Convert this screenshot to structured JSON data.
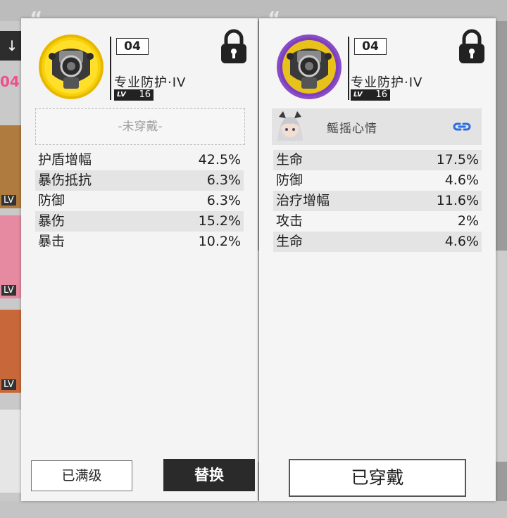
{
  "background": {
    "sort_arrow": "↓",
    "side_number": "04",
    "side_lv_label": "LV"
  },
  "left_card": {
    "item_number": "04",
    "equip_name": "专业防护·IV",
    "lv_label": "LV",
    "level": "16",
    "unworn_label": "-未穿戴-",
    "stats": [
      {
        "name": "护盾增幅",
        "value": "42.5%"
      },
      {
        "name": "暴伤抵抗",
        "value": "6.3%"
      },
      {
        "name": "防御",
        "value": "6.3%"
      },
      {
        "name": "暴伤",
        "value": "15.2%"
      },
      {
        "name": "暴击",
        "value": "10.2%"
      }
    ],
    "max_level_button": "已满级",
    "replace_button": "替换",
    "icon_ring_color": "#e8b800",
    "lock_icon": "padlock-icon"
  },
  "right_card": {
    "item_number": "04",
    "equip_name": "专业防护·IV",
    "lv_label": "LV",
    "level": "16",
    "wearer_name": "鳐摇心情",
    "stats": [
      {
        "name": "生命",
        "value": "17.5%"
      },
      {
        "name": "防御",
        "value": "4.6%"
      },
      {
        "name": "治疗增幅",
        "value": "11.6%"
      },
      {
        "name": "攻击",
        "value": "2%"
      },
      {
        "name": "生命",
        "value": "4.6%"
      }
    ],
    "equipped_button": "已穿戴",
    "icon_ring_color": "#8a4cc6",
    "link_color": "#2a6fe0",
    "lock_icon": "padlock-icon"
  }
}
